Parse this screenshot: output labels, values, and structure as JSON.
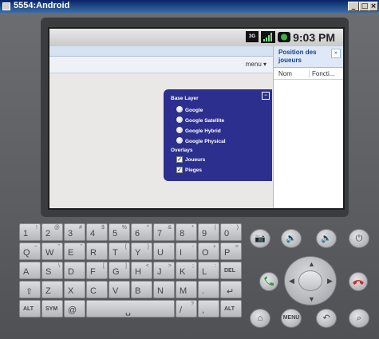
{
  "window": {
    "title": "5554:Android",
    "minimize": "_",
    "maximize": "□",
    "close": "×"
  },
  "status_bar": {
    "network": "3G",
    "time": "9:03 PM"
  },
  "app": {
    "menu_label": "menu ▾",
    "panel": {
      "title": "Position des joueurs",
      "collapse": "»",
      "columns": [
        "Nom",
        "Foncti..."
      ]
    },
    "layer_switcher": {
      "minimize": "−",
      "base_layer_title": "Base Layer",
      "base_layers": [
        "Google",
        "Google Satellite",
        "Google Hybrid",
        "Google Physical"
      ],
      "overlays_title": "Overlays",
      "overlays": [
        {
          "label": "Joueurs",
          "checked": true
        },
        {
          "label": "Pieges",
          "checked": true
        }
      ]
    }
  },
  "keyboard": {
    "row1": [
      {
        "main": "1",
        "sub": "!"
      },
      {
        "main": "2",
        "sub": "@"
      },
      {
        "main": "3",
        "sub": "#"
      },
      {
        "main": "4",
        "sub": "$"
      },
      {
        "main": "5",
        "sub": "%"
      },
      {
        "main": "6",
        "sub": "^"
      },
      {
        "main": "7",
        "sub": "&"
      },
      {
        "main": "8",
        "sub": "*"
      },
      {
        "main": "9",
        "sub": "("
      },
      {
        "main": "0",
        "sub": ")"
      }
    ],
    "row2": [
      {
        "main": "Q",
        "sub": "~"
      },
      {
        "main": "W",
        "sub": "\""
      },
      {
        "main": "E",
        "sub": "\""
      },
      {
        "main": "R",
        "sub": ""
      },
      {
        "main": "T",
        "sub": "{"
      },
      {
        "main": "Y",
        "sub": "}"
      },
      {
        "main": "U",
        "sub": "-"
      },
      {
        "main": "I",
        "sub": "-"
      },
      {
        "main": "O",
        "sub": "+"
      },
      {
        "main": "P",
        "sub": "="
      }
    ],
    "row3": [
      {
        "main": "A",
        "sub": ""
      },
      {
        "main": "S",
        "sub": "\\"
      },
      {
        "main": "D",
        "sub": ""
      },
      {
        "main": "F",
        "sub": "["
      },
      {
        "main": "G",
        "sub": "]"
      },
      {
        "main": "H",
        "sub": "<"
      },
      {
        "main": "J",
        "sub": ">"
      },
      {
        "main": "K",
        "sub": ";"
      },
      {
        "main": "L",
        "sub": ":"
      },
      {
        "main": "DEL",
        "sub": ""
      }
    ],
    "row4": [
      {
        "main": "⇧",
        "sub": ""
      },
      {
        "main": "Z",
        "sub": ""
      },
      {
        "main": "X",
        "sub": ""
      },
      {
        "main": "C",
        "sub": ""
      },
      {
        "main": "V",
        "sub": ""
      },
      {
        "main": "B",
        "sub": ""
      },
      {
        "main": "N",
        "sub": ""
      },
      {
        "main": "M",
        "sub": ""
      },
      {
        "main": ".",
        "sub": ""
      },
      {
        "main": "↵",
        "sub": ""
      }
    ],
    "row5": [
      {
        "main": "ALT",
        "sub": ""
      },
      {
        "main": "SYM",
        "sub": ""
      },
      {
        "main": "@",
        "sub": ""
      },
      {
        "main": "␣",
        "sub": ""
      },
      {
        "main": "/",
        "sub": "?"
      },
      {
        "main": ",",
        "sub": ""
      },
      {
        "main": "ALT",
        "sub": ""
      }
    ],
    "menu_label": "MENU"
  }
}
